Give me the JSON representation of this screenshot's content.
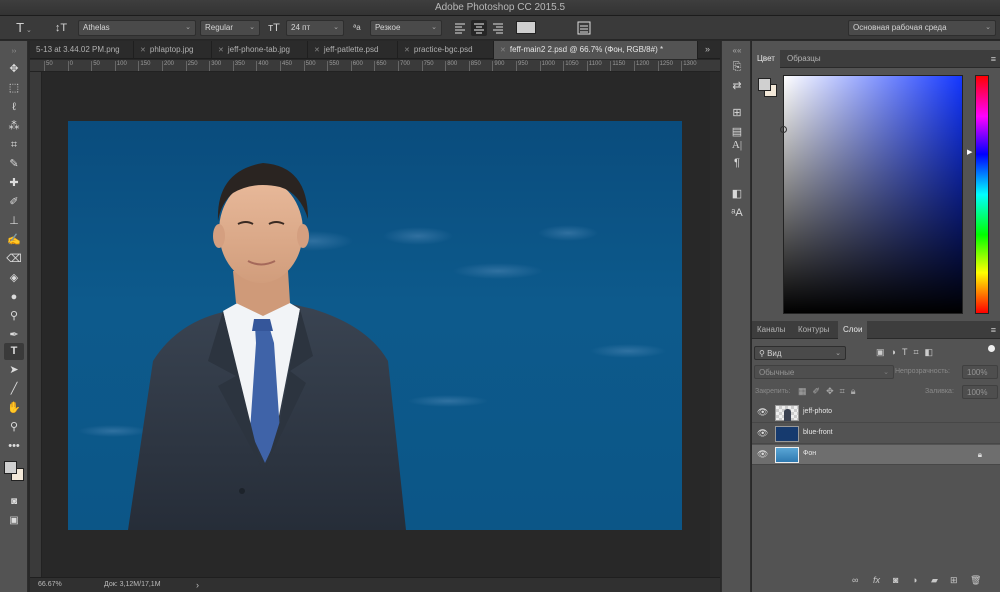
{
  "window": {
    "title": "Adobe Photoshop CC 2015.5"
  },
  "options_bar": {
    "font_family": "Athelas",
    "font_style": "Regular",
    "font_size": "24 пт",
    "antialias": "Резкое",
    "workspace": "Основная рабочая среда"
  },
  "tabs": [
    {
      "label": "5-13 at 3.44.02 PM.png",
      "active": false
    },
    {
      "label": "phlaptop.jpg",
      "active": false
    },
    {
      "label": "jeff-phone-tab.jpg",
      "active": false
    },
    {
      "label": "jeff-patlette.psd",
      "active": false
    },
    {
      "label": "practice-bgc.psd",
      "active": false
    },
    {
      "label": "feff-main2 2.psd @ 66.7% (Фон, RGB/8#) *",
      "active": true
    }
  ],
  "ruler": {
    "ticks": [
      "50",
      "0",
      "50",
      "100",
      "150",
      "200",
      "250",
      "300",
      "350",
      "400",
      "450",
      "500",
      "550",
      "600",
      "650",
      "700",
      "750",
      "800",
      "850",
      "900",
      "950",
      "1000",
      "1050",
      "1100",
      "1150",
      "1200",
      "1250",
      "1300"
    ]
  },
  "status_bar": {
    "zoom": "66.67%",
    "doc_info": "Док: 3,12М/17,1М",
    "arrow": "›"
  },
  "color_panel": {
    "tabs": [
      "Цвет",
      "Образцы"
    ],
    "hue_color": "#1437ff",
    "foreground": "#d0d0d0",
    "background": "#f3e8d8"
  },
  "layers_panel": {
    "tabs": [
      "Каналы",
      "Контуры",
      "Слои"
    ],
    "filter_kind": "Вид",
    "blend_mode": "Обычные",
    "opacity_label": "Непрозрачность:",
    "opacity_value": "100%",
    "lock_label": "Закрепить:",
    "fill_label": "Заливка:",
    "fill_value": "100%",
    "layers": [
      {
        "name": "jeff-photo",
        "selected": false,
        "locked": false
      },
      {
        "name": "blue-front",
        "selected": false,
        "locked": false
      },
      {
        "name": "Фон",
        "selected": true,
        "locked": true
      }
    ]
  },
  "colors": {
    "canvas_blue": "#0c5587",
    "ui_panel": "#535353",
    "pasteboard": "#282828"
  }
}
